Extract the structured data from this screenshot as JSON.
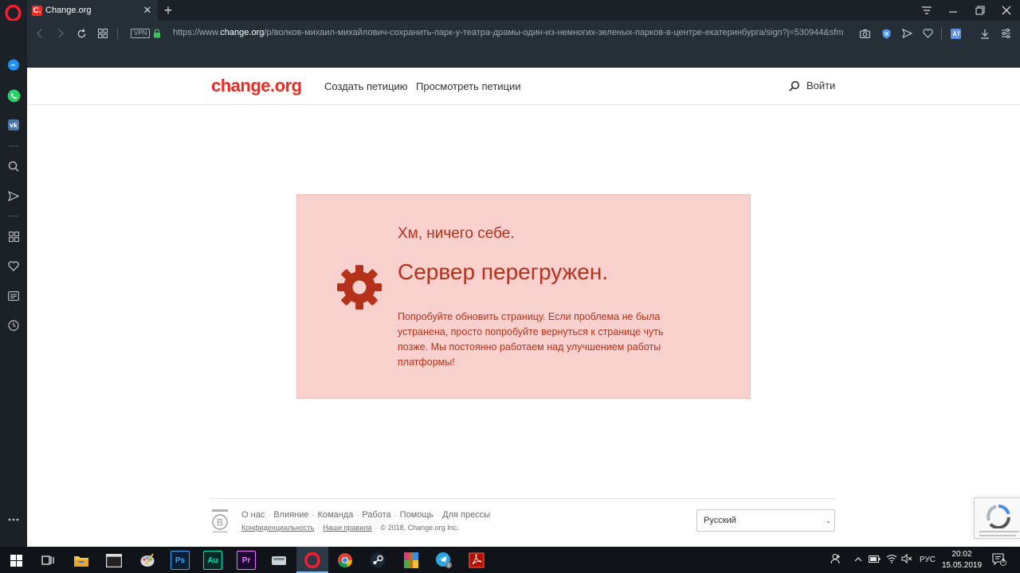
{
  "browser": {
    "tab_favicon": "C.",
    "tab_title": "Change.org",
    "url_prefix": "https://www.",
    "url_host": "change.org",
    "url_path": "/p/волков-михаил-михайлович-сохранить-парк-у-театра-драмы-один-из-немногих-зеленых-парков-в-центре-екатеринбурга/sign?j=530944&sfm",
    "vpn_label": "VPN"
  },
  "site": {
    "brand": "change.org",
    "nav": {
      "create": "Создать петицию",
      "browse": "Просмотреть петиции",
      "login": "Войти"
    },
    "error": {
      "subtitle": "Хм, ничего себе.",
      "title": "Сервер перегружен.",
      "message": "Попробуйте обновить страницу. Если проблема не была устранена, просто попробуйте вернуться к странице чуть позже. Мы постоянно работаем над улучшением работы платформы!"
    },
    "footer": {
      "links": [
        "О нас",
        "Влияние",
        "Команда",
        "Работа",
        "Помощь",
        "Для прессы"
      ],
      "privacy": "Конфиденциальность",
      "rules": "Наши правила",
      "copyright": "© 2018, Change.org Inc.",
      "language": "Русский"
    }
  },
  "taskbar": {
    "lang": "РУС",
    "time": "20:02",
    "date": "15.05.2019",
    "notifications": "3"
  },
  "colors": {
    "brand_red": "#ec2c22",
    "error_bg": "#f8d1cf",
    "error_text": "#b5321a"
  }
}
